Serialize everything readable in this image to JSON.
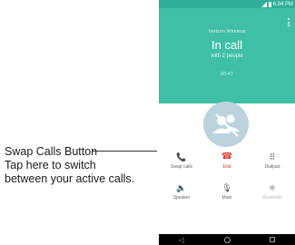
{
  "callout": {
    "title": "Swap Calls Button",
    "line1": "Tap here to switch",
    "line2": "between your active calls."
  },
  "status_bar": {
    "time": "6:34 PM"
  },
  "call": {
    "carrier": "Verizon Wireless",
    "status": "In call",
    "participants": "with 2 people",
    "timer": "00:47"
  },
  "controls": [
    {
      "label": "Swap calls",
      "icon": "swap-calls-icon"
    },
    {
      "label": "End",
      "icon": "end-call-icon"
    },
    {
      "label": "Dialpad",
      "icon": "dialpad-icon"
    },
    {
      "label": "Speaker",
      "icon": "speaker-icon"
    },
    {
      "label": "Mute",
      "icon": "mute-icon"
    },
    {
      "label": "Bluetooth",
      "icon": "bluetooth-icon"
    }
  ],
  "colors": {
    "header": "#3fbfa6",
    "statusbar": "#2eaf99",
    "end": "#e53935",
    "avatar_bg": "#bcd3dc"
  }
}
